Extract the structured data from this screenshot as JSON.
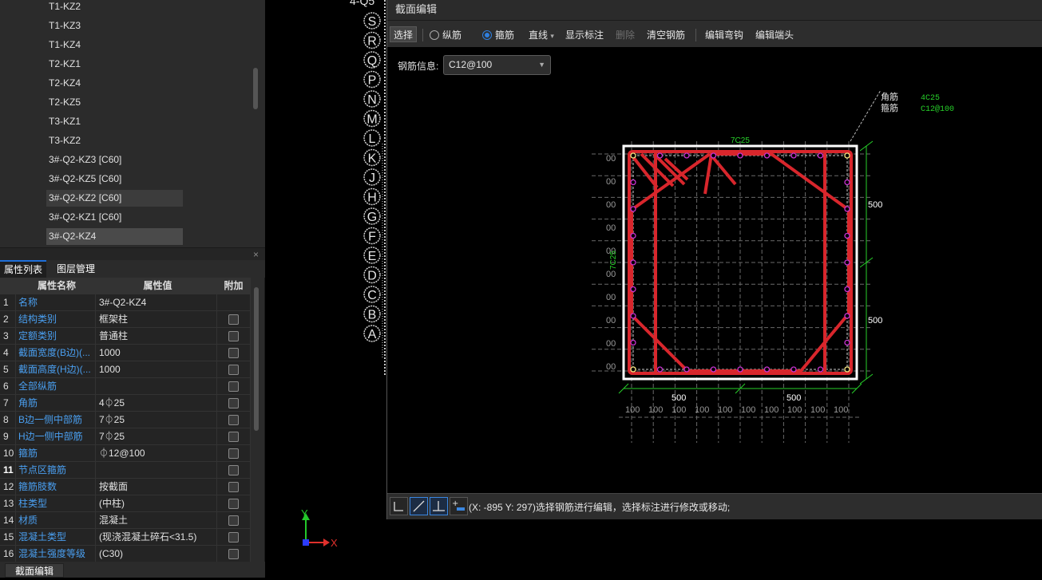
{
  "tree": {
    "items": [
      "T1-KZ2",
      "T1-KZ3",
      "T1-KZ4",
      "T2-KZ1",
      "T2-KZ4",
      "T2-KZ5",
      "T3-KZ1",
      "T3-KZ2",
      "3#-Q2-KZ3 [C60]",
      "3#-Q2-KZ5 [C60]",
      "3#-Q2-KZ2 [C60]",
      "3#-Q2-KZ1 [C60]",
      "3#-Q2-KZ4"
    ]
  },
  "panel": {
    "close_icon": "×",
    "tab_props": "属性列表",
    "tab_layers": "图层管理"
  },
  "props": {
    "header": {
      "name": "属性名称",
      "value": "属性值",
      "extra": "附加"
    },
    "rows": [
      {
        "num": "1",
        "name": "名称",
        "value": "3#-Q2-KZ4",
        "cb": false
      },
      {
        "num": "2",
        "name": "结构类别",
        "value": "框架柱",
        "cb": true
      },
      {
        "num": "3",
        "name": "定额类别",
        "value": "普通柱",
        "cb": true
      },
      {
        "num": "4",
        "name": "截面宽度(B边)(...",
        "value": "1000",
        "cb": true
      },
      {
        "num": "5",
        "name": "截面高度(H边)(...",
        "value": "1000",
        "cb": true
      },
      {
        "num": "6",
        "name": "全部纵筋",
        "value": "",
        "cb": true
      },
      {
        "num": "7",
        "name": "角筋",
        "value": "4⏀25",
        "cb": true
      },
      {
        "num": "8",
        "name": "B边一侧中部筋",
        "value": "7⏀25",
        "cb": true
      },
      {
        "num": "9",
        "name": "H边一侧中部筋",
        "value": "7⏀25",
        "cb": true
      },
      {
        "num": "10",
        "name": "箍筋",
        "value": "⏀12@100",
        "cb": true
      },
      {
        "num": "11",
        "name": "节点区箍筋",
        "value": "",
        "cb": true
      },
      {
        "num": "12",
        "name": "箍筋肢数",
        "value": "按截面",
        "cb": true
      },
      {
        "num": "13",
        "name": "柱类型",
        "value": "(中柱)",
        "cb": true
      },
      {
        "num": "14",
        "name": "材质",
        "value": "混凝土",
        "cb": true
      },
      {
        "num": "15",
        "name": "混凝土类型",
        "value": "(现浇混凝土碎石<31.5)",
        "cb": true
      },
      {
        "num": "16",
        "name": "混凝土强度等级",
        "value": "(C30)",
        "cb": true
      }
    ]
  },
  "bottom_tab": "截面编辑",
  "grid_labels": [
    "S",
    "R",
    "Q",
    "P",
    "N",
    "M",
    "L",
    "K",
    "J",
    "H",
    "G",
    "F",
    "E",
    "D",
    "C",
    "B",
    "A"
  ],
  "grid_top_label": "4-Q5",
  "axis": {
    "x": "X",
    "y": "Y"
  },
  "dialog": {
    "title": "截面编辑",
    "toolbar": {
      "select": "选择",
      "longitudinal": "纵筋",
      "stirrup": "箍筋",
      "line": "直线",
      "line_arrow": "▾",
      "show_annot": "显示标注",
      "delete": "删除",
      "clear": "清空钢筋",
      "edit_hook": "编辑弯钩",
      "edit_end": "编辑端头"
    },
    "rebar_info_label": "钢筋信息:",
    "rebar_info_value": "C12@100",
    "status_text": "(X: -895 Y: 297)选择钢筋进行编辑，选择标注进行修改或移动;"
  },
  "drawing": {
    "legend": {
      "corner_label": "角筋",
      "corner_value": "4C25",
      "stirrup_label": "箍筋",
      "stirrup_value": "C12@100"
    },
    "top_label": "7C25",
    "side_label": "7C25",
    "right_dims": [
      "500",
      "500"
    ],
    "bottom_dims": [
      "500",
      "500"
    ],
    "small_dims": [
      "100",
      "100",
      "100",
      "100",
      "100",
      "100",
      "100",
      "100",
      "100",
      "100"
    ],
    "left_dims": [
      "00",
      "00",
      "00",
      "00",
      "00",
      "00",
      "00",
      "00",
      "00",
      "00"
    ],
    "colors": {
      "rebar": "#d8262c",
      "dim": "#27d12a",
      "dot": "#c832d0",
      "border": "#ffffff"
    }
  }
}
